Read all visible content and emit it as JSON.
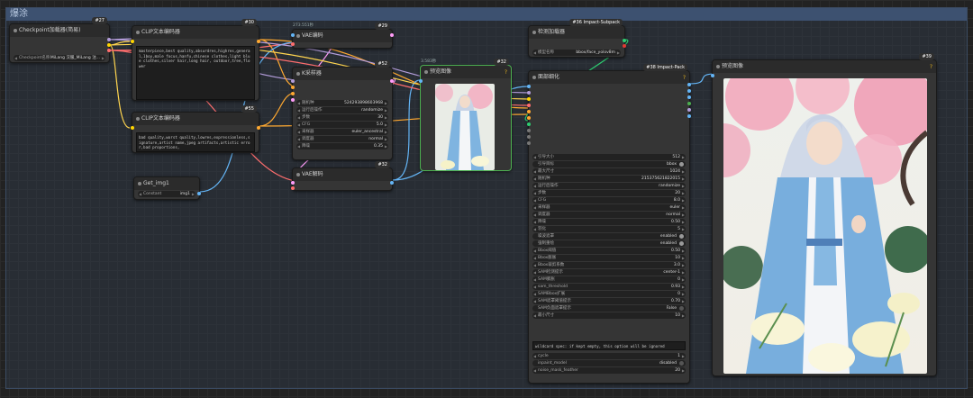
{
  "group": {
    "title": "爆涂"
  },
  "nodes": {
    "checkpoint": {
      "title": "Checkpoint加载器(简易)",
      "id": "#27",
      "widget": {
        "label": "Checkpoint名称",
        "value": "MiLang 汉服_MiLang 注..."
      }
    },
    "clip_pos": {
      "title": "CLIP文本编码器",
      "id": "#30",
      "text": "masterpiece,best quality,absurdres,highres,general,1boy,male focus,hanfu,chinese clothes,light blue clothes,silver hair,long hair, outdoor,tree,flower"
    },
    "clip_neg": {
      "title": "CLIP文本编码器",
      "id": "#55",
      "text": "bad quality,worst quality,lowres,expressionless,signature,artist name,jpeg artifacts,artistic error,bad proportions,"
    },
    "get_img": {
      "title": "Get_img1",
      "widget": {
        "label": "Constant",
        "value": "img1"
      }
    },
    "vae_enc": {
      "title": "VAE编码",
      "id": "#29",
      "timing": "273.551秒"
    },
    "ksampler": {
      "title": "K采样器",
      "id": "#52",
      "widgets": [
        {
          "label": "随机种",
          "value": "524293898603968"
        },
        {
          "label": "运行后操作",
          "value": "randomize"
        },
        {
          "label": "步数",
          "value": "30"
        },
        {
          "label": "CFG",
          "value": "5.0"
        },
        {
          "label": "采样器",
          "value": "euler_ancestral"
        },
        {
          "label": "调度器",
          "value": "normal"
        },
        {
          "label": "降噪",
          "value": "0.35"
        }
      ]
    },
    "vae_dec": {
      "title": "VAE解码",
      "id": "#32"
    },
    "preview1": {
      "title": "预览图像",
      "id": "#32",
      "timing": "3.583秒"
    },
    "detector": {
      "title": "检测加载器",
      "id": "#36 Impact-Subpack",
      "widget": {
        "label": "模型名称",
        "value": "bbox/face_yolov8m"
      }
    },
    "face_detail": {
      "title": "面部细化",
      "id": "#38 Impact-Pack",
      "widgets": [
        {
          "label": "引导大小",
          "value": "512",
          "kind": "num"
        },
        {
          "label": "引导目标",
          "value": "bbox",
          "kind": "tog"
        },
        {
          "label": "最大尺寸",
          "value": "1024",
          "kind": "num"
        },
        {
          "label": "随机种",
          "value": "215375621822015",
          "kind": "num"
        },
        {
          "label": "运行后操作",
          "value": "randomize",
          "kind": "num"
        },
        {
          "label": "步数",
          "value": "20",
          "kind": "num"
        },
        {
          "label": "CFG",
          "value": "8.0",
          "kind": "num"
        },
        {
          "label": "采样器",
          "value": "euler",
          "kind": "num"
        },
        {
          "label": "调度器",
          "value": "normal",
          "kind": "num"
        },
        {
          "label": "降噪",
          "value": "0.50",
          "kind": "num"
        },
        {
          "label": "羽化",
          "value": "5",
          "kind": "num"
        },
        {
          "label": "噪波遮罩",
          "value": "enabled",
          "kind": "tog"
        },
        {
          "label": "强制重绘",
          "value": "enabled",
          "kind": "tog"
        },
        {
          "label": "Bbox阈值",
          "value": "0.50",
          "kind": "num"
        },
        {
          "label": "Bbox膨胀",
          "value": "10",
          "kind": "num"
        },
        {
          "label": "Bbox裁剪系数",
          "value": "3.0",
          "kind": "num"
        },
        {
          "label": "SAM检测提示",
          "value": "center-1",
          "kind": "num"
        },
        {
          "label": "SAM膨胀",
          "value": "0",
          "kind": "num"
        },
        {
          "label": "sam_threshold",
          "value": "0.93",
          "kind": "num"
        },
        {
          "label": "SAMBbox扩展",
          "value": "0",
          "kind": "num"
        },
        {
          "label": "SAM遮罩阈值提示",
          "value": "0.70",
          "kind": "num"
        },
        {
          "label": "SAM负面遮罩提示",
          "value": "False",
          "kind": "tog"
        },
        {
          "label": "最小尺寸",
          "value": "10",
          "kind": "num"
        }
      ],
      "wildcard": "wildcard spec: if kept empty, this option will be ignored",
      "extra": [
        {
          "label": "cycle",
          "value": "1",
          "kind": "num"
        },
        {
          "label": "inpaint_model",
          "value": "disabled",
          "kind": "tog"
        },
        {
          "label": "noise_mask_feather",
          "value": "20",
          "kind": "num"
        }
      ]
    },
    "preview2": {
      "title": "预览图像",
      "id": "#39"
    }
  },
  "colors": {
    "model": "#b39ddb",
    "clip": "#ffd500",
    "vae": "#ff6e6e",
    "conditioning": "#ffa931",
    "latent": "#ff9cf9",
    "image": "#64b5f6",
    "bbox": "#2ecc71",
    "link_yellow": "#ffd54f"
  },
  "icons": {
    "help": "question-icon",
    "collapse": "collapse-dot-icon"
  }
}
